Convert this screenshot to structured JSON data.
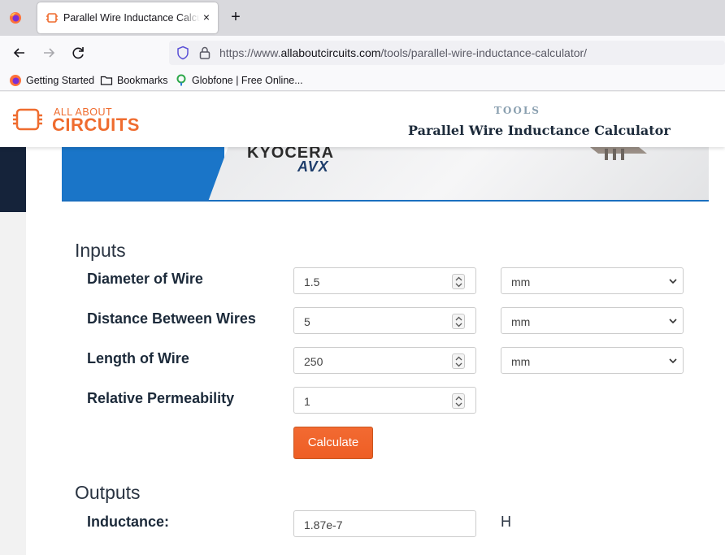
{
  "browser": {
    "tab_title": "Parallel Wire Inductance Calculator",
    "tab_close": "×",
    "new_tab": "+",
    "url_prefix": "https://www.",
    "url_domain": "allaboutcircuits.com",
    "url_path": "/tools/parallel-wire-inductance-calculator/",
    "bookmarks": [
      "Getting Started",
      "Bookmarks",
      "Globfone | Free Online..."
    ]
  },
  "site": {
    "logo_small": "ALL ABOUT",
    "logo_big": "CIRCUITS",
    "section_label": "TOOLS",
    "page_title": "Parallel Wire Inductance Calculator",
    "brand_color": "#ef6c2f"
  },
  "banner": {
    "brand1": "KYOCERA",
    "brand2": "AVX"
  },
  "inputs": {
    "title": "Inputs",
    "fields": [
      {
        "label": "Diameter of Wire",
        "value": "1.5",
        "unit": "mm"
      },
      {
        "label": "Distance Between Wires",
        "value": "5",
        "unit": "mm"
      },
      {
        "label": "Length of Wire",
        "value": "250",
        "unit": "mm"
      },
      {
        "label": "Relative Permeability",
        "value": "1"
      }
    ],
    "calculate_label": "Calculate"
  },
  "outputs": {
    "title": "Outputs",
    "fields": [
      {
        "label": "Inductance:",
        "value": "1.87e-7",
        "unit": "H"
      }
    ]
  }
}
